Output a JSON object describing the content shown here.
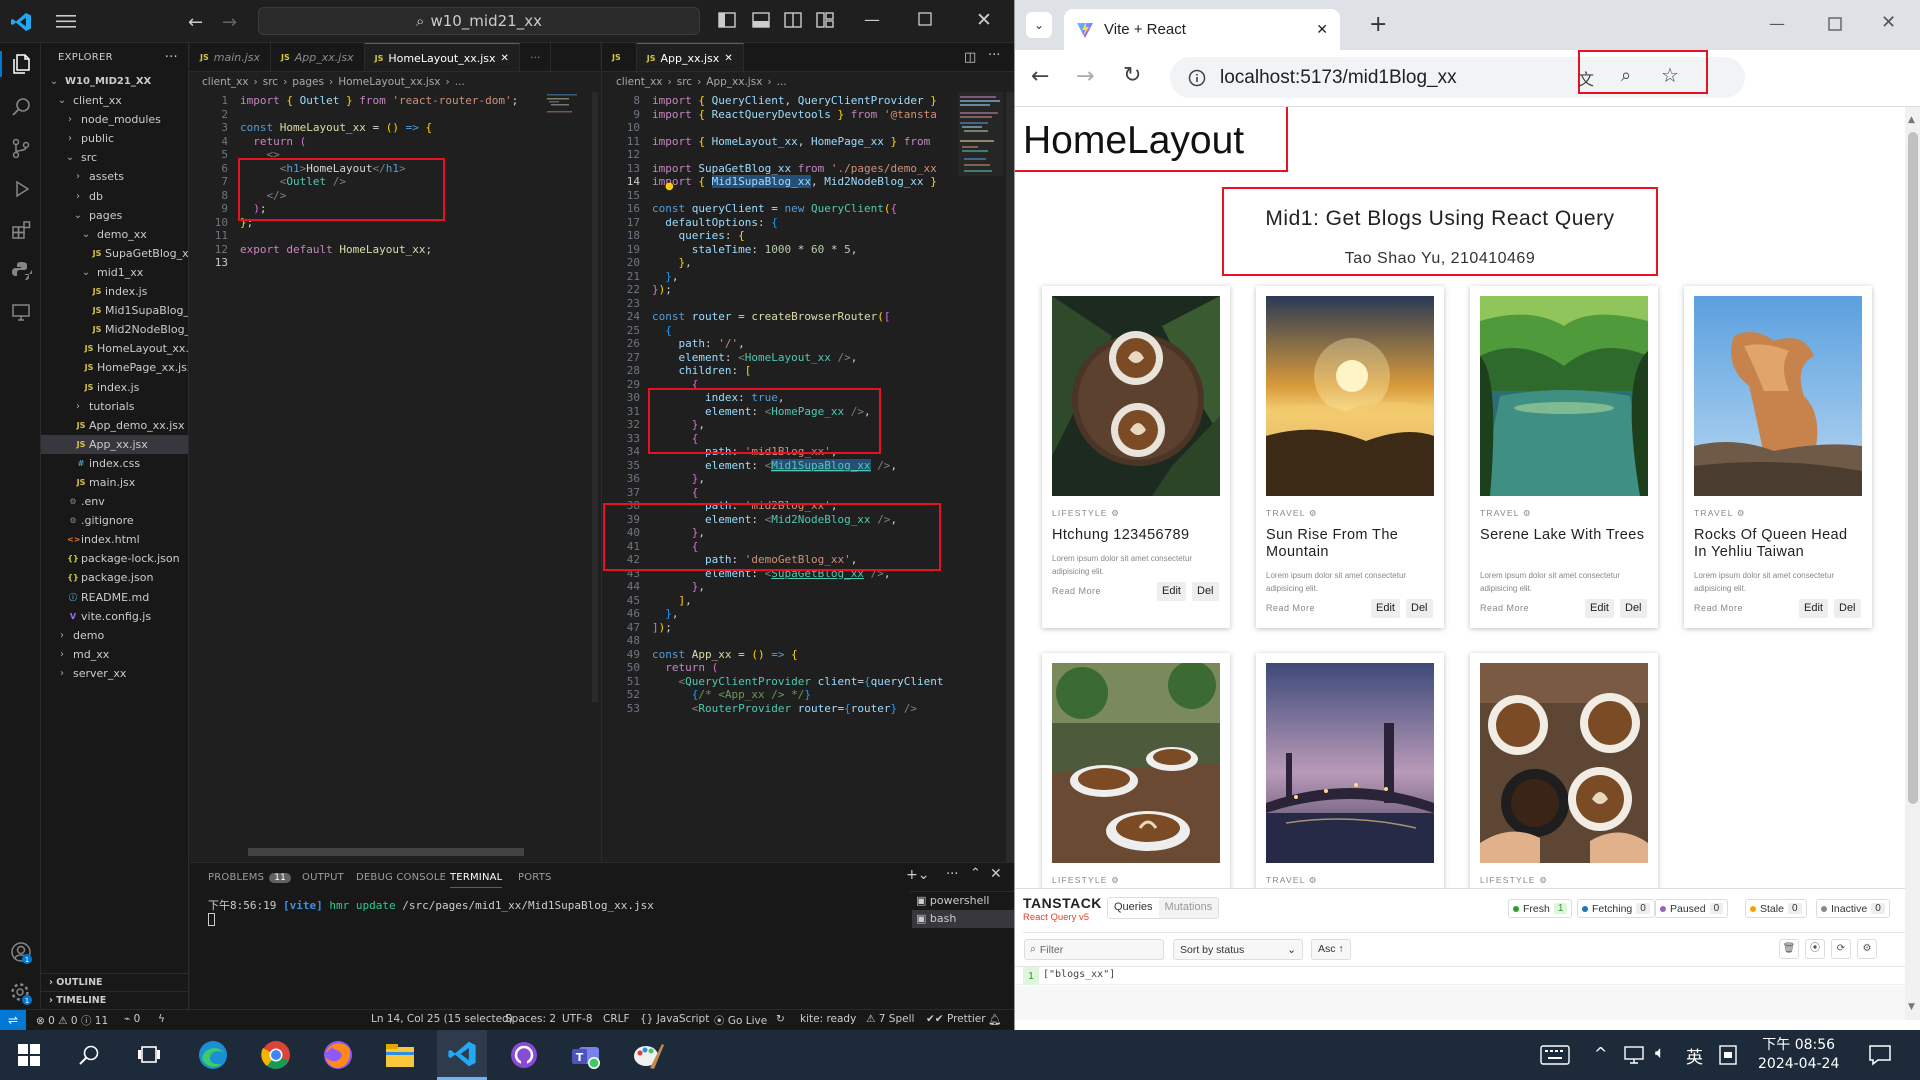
{
  "vscode": {
    "title_search": "w10_mid21_xx",
    "explorer": {
      "header": "EXPLORER",
      "tree": [
        {
          "label": "W10_MID21_XX",
          "depth": 0,
          "kind": "folder-open",
          "bold": true
        },
        {
          "label": "client_xx",
          "depth": 1,
          "kind": "folder-open"
        },
        {
          "label": "node_modules",
          "depth": 2,
          "kind": "folder"
        },
        {
          "label": "public",
          "depth": 2,
          "kind": "folder"
        },
        {
          "label": "src",
          "depth": 2,
          "kind": "folder-open"
        },
        {
          "label": "assets",
          "depth": 3,
          "kind": "folder"
        },
        {
          "label": "db",
          "depth": 3,
          "kind": "folder"
        },
        {
          "label": "pages",
          "depth": 3,
          "kind": "folder-open"
        },
        {
          "label": "demo_xx",
          "depth": 4,
          "kind": "folder-open"
        },
        {
          "label": "SupaGetBlog_xx...",
          "depth": 5,
          "kind": "js"
        },
        {
          "label": "mid1_xx",
          "depth": 4,
          "kind": "folder-open"
        },
        {
          "label": "index.js",
          "depth": 5,
          "kind": "js"
        },
        {
          "label": "Mid1SupaBlog_...",
          "depth": 5,
          "kind": "js"
        },
        {
          "label": "Mid2NodeBlog_...",
          "depth": 5,
          "kind": "js"
        },
        {
          "label": "HomeLayout_xx.jsx",
          "depth": 4,
          "kind": "js"
        },
        {
          "label": "HomePage_xx.jsx",
          "depth": 4,
          "kind": "js"
        },
        {
          "label": "index.js",
          "depth": 4,
          "kind": "js"
        },
        {
          "label": "tutorials",
          "depth": 3,
          "kind": "folder"
        },
        {
          "label": "App_demo_xx.jsx",
          "depth": 3,
          "kind": "js"
        },
        {
          "label": "App_xx.jsx",
          "depth": 3,
          "kind": "js",
          "selected": true
        },
        {
          "label": "index.css",
          "depth": 3,
          "kind": "css"
        },
        {
          "label": "main.jsx",
          "depth": 3,
          "kind": "js"
        },
        {
          "label": ".env",
          "depth": 2,
          "kind": "dot"
        },
        {
          "label": ".gitignore",
          "depth": 2,
          "kind": "dot"
        },
        {
          "label": "index.html",
          "depth": 2,
          "kind": "html"
        },
        {
          "label": "package-lock.json",
          "depth": 2,
          "kind": "json"
        },
        {
          "label": "package.json",
          "depth": 2,
          "kind": "json"
        },
        {
          "label": "README.md",
          "depth": 2,
          "kind": "info"
        },
        {
          "label": "vite.config.js",
          "depth": 2,
          "kind": "vite"
        },
        {
          "label": "demo",
          "depth": 1,
          "kind": "folder"
        },
        {
          "label": "md_xx",
          "depth": 1,
          "kind": "folder"
        },
        {
          "label": "server_xx",
          "depth": 1,
          "kind": "folder"
        }
      ],
      "outline": "OUTLINE",
      "timeline": "TIMELINE"
    },
    "left_editor": {
      "tabs": [
        {
          "label": "main.jsx",
          "active": false
        },
        {
          "label": "App_xx.jsx",
          "active": false
        },
        {
          "label": "HomeLayout_xx.jsx",
          "active": true
        }
      ],
      "breadcrumb": [
        "client_xx",
        "src",
        "pages",
        "HomeLayout_xx.jsx",
        "..."
      ],
      "lines": [
        {
          "n": 1,
          "html": "<span class='ctl'>import</span> <span class='br'>{</span> <span class='var'>Outlet</span> <span class='br'>}</span> <span class='ctl'>from</span> <span class='str'>'react-router-dom'</span>;"
        },
        {
          "n": 2,
          "html": ""
        },
        {
          "n": 3,
          "html": "<span class='kw'>const</span> <span class='fn'>HomeLayout_xx</span> = <span class='br'>()</span> <span class='kw'>=&gt;</span> <span class='br'>{</span>"
        },
        {
          "n": 4,
          "html": "  <span class='ctl'>return</span> <span class='br2'>(</span>"
        },
        {
          "n": 5,
          "html": "    <span class='pun'>&lt;&gt;</span>"
        },
        {
          "n": 6,
          "html": "      <span class='pun'>&lt;</span><span class='ptag'>h1</span><span class='pun'>&gt;</span>HomeLayout<span class='pun'>&lt;/</span><span class='ptag'>h1</span><span class='pun'>&gt;</span>"
        },
        {
          "n": 7,
          "html": "      <span class='pun'>&lt;</span><span class='tag'>Outlet</span> <span class='pun'>/&gt;</span>"
        },
        {
          "n": 8,
          "html": "    <span class='pun'>&lt;/&gt;</span>"
        },
        {
          "n": 9,
          "html": "  <span class='br2'>)</span>;"
        },
        {
          "n": 10,
          "html": "<span class='br'>}</span>;"
        },
        {
          "n": 11,
          "html": ""
        },
        {
          "n": 12,
          "html": "<span class='ctl'>export</span> <span class='ctl'>default</span> <span class='fn'>HomeLayout_xx</span>;"
        },
        {
          "n": 13,
          "html": ""
        }
      ],
      "current_line": 13
    },
    "right_editor": {
      "tabs": [
        {
          "label": "",
          "active": false
        },
        {
          "label": "App_xx.jsx",
          "active": true
        }
      ],
      "breadcrumb": [
        "client_xx",
        "src",
        "App_xx.jsx",
        "..."
      ],
      "lines": [
        {
          "n": 8,
          "html": "<span class='ctl'>import</span> <span class='br'>{</span> <span class='var'>QueryClient</span>, <span class='var'>QueryClientProvider</span> <span class='br'>}</span>"
        },
        {
          "n": 9,
          "html": "<span class='ctl'>import</span> <span class='br'>{</span> <span class='var'>ReactQueryDevtools</span> <span class='br'>}</span> <span class='ctl'>from</span> <span class='str'>'@tansta</span>"
        },
        {
          "n": 10,
          "html": ""
        },
        {
          "n": 11,
          "html": "<span class='ctl'>import</span> <span class='br'>{</span> <span class='var'>HomeLayout_xx</span>, <span class='var'>HomePage_xx</span> <span class='br'>}</span> <span class='ctl'>from</span>"
        },
        {
          "n": 12,
          "html": ""
        },
        {
          "n": 13,
          "html": "<span class='ctl'>import</span> <span class='var'>SupaGetBlog_xx</span> <span class='ctl'>from</span> <span class='str'>'./pages/demo_xx</span>"
        },
        {
          "n": 14,
          "html": "<span class='ctl'>import</span> <span class='br'>{</span> <span class='var' style='background:#264f78'>Mid1SupaBlog_xx</span>, <span class='var'>Mid2NodeBlog_xx</span> <span class='br'>}</span>"
        },
        {
          "n": 15,
          "html": ""
        },
        {
          "n": 16,
          "html": "<span class='kw'>const</span> <span class='var'>queryClient</span> = <span class='kw'>new</span> <span class='tag'>QueryClient</span><span class='br'>(</span><span class='br2'>{</span>"
        },
        {
          "n": 17,
          "html": "  <span class='var'>defaultOptions</span>: <span class='br3'>{</span>"
        },
        {
          "n": 18,
          "html": "    <span class='var'>queries</span>: <span class='br'>{</span>"
        },
        {
          "n": 19,
          "html": "      <span class='var'>staleTime</span>: <span class='num'>1000</span> * <span class='num'>60</span> * <span class='num'>5</span>,"
        },
        {
          "n": 20,
          "html": "    <span class='br'>}</span>,"
        },
        {
          "n": 21,
          "html": "  <span class='br3'>}</span>,"
        },
        {
          "n": 22,
          "html": "<span class='br2'>}</span><span class='br'>)</span>;"
        },
        {
          "n": 23,
          "html": ""
        },
        {
          "n": 24,
          "html": "<span class='kw'>const</span> <span class='var'>router</span> = <span class='fn'>createBrowserRouter</span><span class='br'>(</span><span class='br2'>[</span>"
        },
        {
          "n": 25,
          "html": "  <span class='br3'>{</span>"
        },
        {
          "n": 26,
          "html": "    <span class='var'>path</span>: <span class='str'>'/'</span>,"
        },
        {
          "n": 27,
          "html": "    <span class='var'>element</span>: <span class='pun'>&lt;</span><span class='tag'>HomeLayout_xx</span> <span class='pun'>/&gt;</span>,"
        },
        {
          "n": 28,
          "html": "    <span class='var'>children</span>: <span class='br'>[</span>"
        },
        {
          "n": 29,
          "html": "      <span class='br2'>{</span>"
        },
        {
          "n": 30,
          "html": "        <span class='var'>index</span>: <span class='kw'>true</span>,"
        },
        {
          "n": 31,
          "html": "        <span class='var'>element</span>: <span class='pun'>&lt;</span><span class='tag'>HomePage_xx</span> <span class='pun'>/&gt;</span>,"
        },
        {
          "n": 32,
          "html": "      <span class='br2'>}</span>,"
        },
        {
          "n": 33,
          "html": "      <span class='br2'>{</span>"
        },
        {
          "n": 34,
          "html": "        <span class='var'>path</span>: <span class='str'>'mid1Blog_xx'</span>,"
        },
        {
          "n": 35,
          "html": "        <span class='var'>element</span>: <span class='pun'>&lt;</span><span class='tag' style='text-decoration:underline;background:#264f78'>Mid1SupaBlog_xx</span> <span class='pun'>/&gt;</span>,"
        },
        {
          "n": 36,
          "html": "      <span class='br2'>}</span>,"
        },
        {
          "n": 37,
          "html": "      <span class='br2'>{</span>"
        },
        {
          "n": 38,
          "html": "        <span class='var'>path</span>: <span class='str'>'mid2Blog_xx'</span>,"
        },
        {
          "n": 39,
          "html": "        <span class='var'>element</span>: <span class='pun'>&lt;</span><span class='tag'>Mid2NodeBlog_xx</span> <span class='pun'>/&gt;</span>,"
        },
        {
          "n": 40,
          "html": "      <span class='br2'>}</span>,"
        },
        {
          "n": 41,
          "html": "      <span class='br2'>{</span>"
        },
        {
          "n": 42,
          "html": "        <span class='var'>path</span>: <span class='str'>'demoGetBlog_xx'</span>,"
        },
        {
          "n": 43,
          "html": "        <span class='var'>element</span>: <span class='pun'>&lt;</span><span class='tag' style='text-decoration:underline'>SupaGetBlog_xx</span> <span class='pun'>/&gt;</span>,"
        },
        {
          "n": 44,
          "html": "      <span class='br2'>}</span>,"
        },
        {
          "n": 45,
          "html": "    <span class='br'>]</span>,"
        },
        {
          "n": 46,
          "html": "  <span class='br3'>}</span>,"
        },
        {
          "n": 47,
          "html": "<span class='br2'>]</span><span class='br'>)</span>;"
        },
        {
          "n": 48,
          "html": ""
        },
        {
          "n": 49,
          "html": "<span class='kw'>const</span> <span class='fn'>App_xx</span> = <span class='br'>()</span> <span class='kw'>=&gt;</span> <span class='br'>{</span>"
        },
        {
          "n": 50,
          "html": "  <span class='ctl'>return</span> <span class='br2'>(</span>"
        },
        {
          "n": 51,
          "html": "    <span class='pun'>&lt;</span><span class='tag'>QueryClientProvider</span> <span class='var'>client</span>=<span class='br3'>{</span><span class='var'>queryClient</span>"
        },
        {
          "n": 52,
          "html": "      <span class='br3'>{</span><span class='cmt'>/* &lt;App_xx /&gt; */</span><span class='br3'>}</span>"
        },
        {
          "n": 53,
          "html": "      <span class='pun'>&lt;</span><span class='tag'>RouterProvider</span> <span class='var'>router</span>=<span class='br3'>{</span><span class='var'>router</span><span class='br3'>}</span> <span class='pun'>/&gt;</span>"
        }
      ],
      "current_line": 14
    },
    "panel": {
      "tabs": [
        "PROBLEMS",
        "OUTPUT",
        "DEBUG CONSOLE",
        "TERMINAL",
        "PORTS"
      ],
      "problems_count": "11",
      "terminal_time": "下午8:56:19",
      "terminal_vite": "[vite]",
      "terminal_msg": "hmr update",
      "terminal_path": "/src/pages/mid1_xx/Mid1SupaBlog_xx.jsx",
      "terminals": [
        "powershell",
        "bash"
      ]
    },
    "status": {
      "errors": "0",
      "warnings": "0",
      "info": "11",
      "ports": "0",
      "cursor": "Ln 14, Col 25 (15 selected)",
      "spaces": "Spaces: 2",
      "encoding": "UTF-8",
      "eol": "CRLF",
      "language": "JavaScript",
      "golive": "Go Live",
      "kite": "kite: ready",
      "spell": "7 Spell",
      "prettier": "Prettier"
    }
  },
  "chrome": {
    "tab_title": "Vite + React",
    "url": "localhost:5173/mid1Blog_xx",
    "page": {
      "h1": "HomeLayout",
      "title": "Mid1: Get Blogs Using React Query",
      "subtitle": "Tao Shao Yu, 210410469",
      "read_more": "Read More",
      "edit": "Edit",
      "del": "Del",
      "lorem": "Lorem ipsum dolor sit amet consectetur adipisicing elit.",
      "cards": [
        {
          "category": "LIFESTYLE",
          "title": "Htchung 123456789",
          "image": "coffee-top"
        },
        {
          "category": "TRAVEL",
          "title": "Sun Rise From The Mountain",
          "image": "sunrise"
        },
        {
          "category": "TRAVEL",
          "title": "Serene Lake With Trees",
          "image": "lake"
        },
        {
          "category": "TRAVEL",
          "title": "Rocks Of Queen Head In Yehliu Taiwan",
          "image": "rocks"
        },
        {
          "category": "LIFESTYLE",
          "title": "",
          "image": "coffee-cups"
        },
        {
          "category": "TRAVEL",
          "title": "",
          "image": "bridge"
        },
        {
          "category": "LIFESTYLE",
          "title": "",
          "image": "coffee-hands"
        }
      ]
    },
    "devtools": {
      "brand": "TANSTACK",
      "sub": "React Query v5",
      "tabs": [
        "Queries",
        "Mutations"
      ],
      "filters": [
        {
          "label": "Fresh",
          "count": "1",
          "color": "#2ca02c"
        },
        {
          "label": "Fetching",
          "count": "0",
          "color": "#1f77b4"
        },
        {
          "label": "Paused",
          "count": "0",
          "color": "#9467bd"
        },
        {
          "label": "Stale",
          "count": "0",
          "color": "#f0a500"
        },
        {
          "label": "Inactive",
          "count": "0",
          "color": "#888888"
        }
      ],
      "filter_placeholder": "Filter",
      "sort": "Sort by status",
      "order": "Asc ↑",
      "query_count": "1",
      "query_key": "[\"blogs_xx\"]"
    }
  },
  "taskbar": {
    "ime": "英",
    "time": "下午 08:56",
    "date": "2024-04-24"
  }
}
